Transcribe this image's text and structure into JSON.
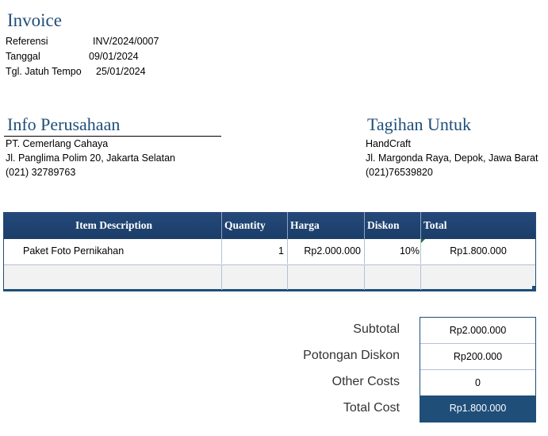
{
  "invoice": {
    "title": "Invoice",
    "meta": [
      {
        "label": "Referensi",
        "value": "INV/2024/0007"
      },
      {
        "label": "Tanggal",
        "value": "09/01/2024"
      },
      {
        "label": "Tgl. Jatuh Tempo",
        "value": "25/01/2024"
      }
    ]
  },
  "company": {
    "title": "Info Perusahaan",
    "name": "PT. Cemerlang Cahaya",
    "address": "Jl. Panglima Polim 20, Jakarta Selatan",
    "phone": "(021) 32789763"
  },
  "bill_to": {
    "title": "Tagihan Untuk",
    "name": "HandCraft",
    "address": "Jl. Margonda Raya, Depok, Jawa Barat",
    "phone": "(021)76539820"
  },
  "table": {
    "headers": [
      "Item Description",
      "Quantity",
      "Harga",
      "Diskon",
      "Total"
    ],
    "rows": [
      {
        "description": "Paket Foto Pernikahan",
        "quantity": "1",
        "price": "Rp2.000.000",
        "discount": "10%",
        "total": "Rp1.800.000"
      },
      {
        "description": "",
        "quantity": "",
        "price": "",
        "discount": "",
        "total": ""
      }
    ]
  },
  "summary": {
    "subtotal_label": "Subtotal",
    "subtotal_value": "Rp2.000.000",
    "discount_label": "Potongan Diskon",
    "discount_value": "Rp200.000",
    "other_label": "Other Costs",
    "other_value": "0",
    "total_label": "Total Cost",
    "total_value": "Rp1.800.000"
  },
  "colors": {
    "accent": "#1f4e79",
    "header_bg": "#1f4e79",
    "empty_row_bg": "#f2f2f2"
  }
}
